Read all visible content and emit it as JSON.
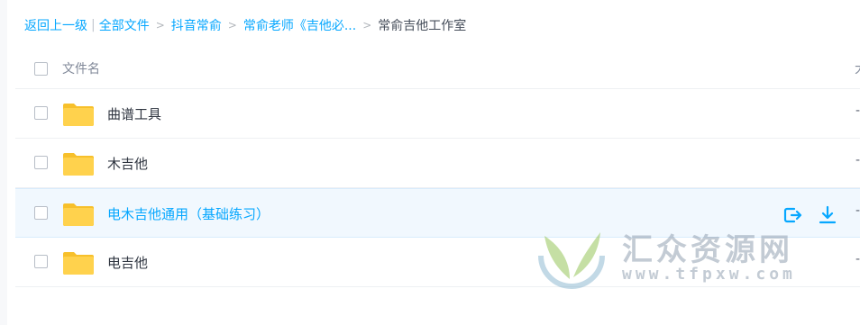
{
  "breadcrumb": {
    "back": "返回上一级",
    "separator": "|",
    "items": [
      "全部文件",
      "抖音常俞",
      "常俞老师《吉他必..."
    ],
    "current": "常俞吉他工作室",
    "chevron_icon": "chevron-right-icon"
  },
  "list_header": {
    "name_label": "文件名",
    "right_label": "大"
  },
  "rows": [
    {
      "name": "曲谱工具",
      "right": "-",
      "icon": "folder-icon",
      "selected": false
    },
    {
      "name": "木吉他",
      "right": "-",
      "icon": "folder-icon",
      "selected": false
    },
    {
      "name": "电木吉他通用（基础练习）",
      "right": "-",
      "icon": "folder-icon",
      "selected": true
    },
    {
      "name": "电吉他",
      "right": "-",
      "icon": "folder-icon",
      "selected": false
    }
  ],
  "row_actions": {
    "share_icon": "share-exit-icon",
    "download_icon": "download-icon"
  },
  "watermark": {
    "title": "汇众资源网",
    "url": "www.tfpxw.com"
  },
  "colors": {
    "accent": "#06a7ff",
    "folder": "#ffd24d",
    "folder_tab": "#f7c02b",
    "selected_row_bg": "#f1f8fe"
  }
}
